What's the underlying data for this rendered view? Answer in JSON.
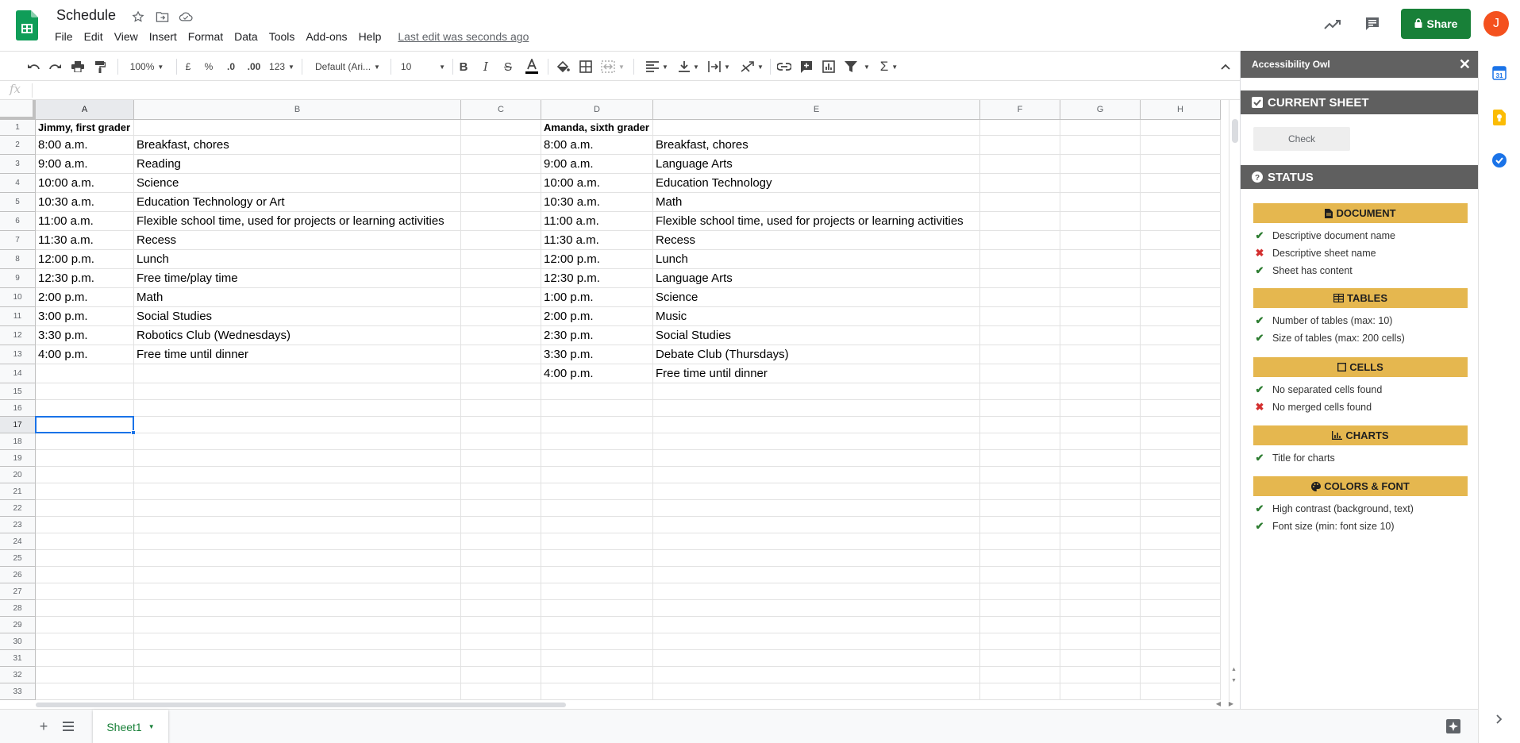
{
  "header": {
    "title": "Schedule",
    "menu": [
      "File",
      "Edit",
      "View",
      "Insert",
      "Format",
      "Data",
      "Tools",
      "Add-ons",
      "Help"
    ],
    "last_edit": "Last edit was seconds ago",
    "share_label": "Share",
    "avatar_initial": "J"
  },
  "toolbar": {
    "zoom": "100%",
    "currency": "£",
    "percent": "%",
    "dec_less": ".0",
    "dec_more": ".00",
    "format_more": "123",
    "font": "Default (Ari...",
    "font_size": "10"
  },
  "formula_bar": {
    "fx": "fx",
    "value": ""
  },
  "grid": {
    "columns": [
      "A",
      "B",
      "C",
      "D",
      "E",
      "F",
      "G",
      "H"
    ],
    "selected_column": "A",
    "selected_row": 17,
    "row_numbers": [
      1,
      2,
      3,
      4,
      5,
      6,
      7,
      8,
      9,
      10,
      11,
      12,
      13,
      14,
      15,
      16,
      17,
      18,
      19,
      20,
      21,
      22,
      23,
      24,
      25,
      26,
      27,
      28,
      29,
      30,
      31,
      32,
      33
    ],
    "rows": [
      [
        "Jimmy, first grader",
        "",
        "",
        "Amanda, sixth grader",
        ""
      ],
      [
        "8:00 a.m.",
        "Breakfast, chores",
        "",
        "8:00 a.m.",
        "Breakfast, chores"
      ],
      [
        "9:00 a.m.",
        "Reading",
        "",
        "9:00 a.m.",
        "Language Arts"
      ],
      [
        "10:00 a.m.",
        "Science",
        "",
        "10:00 a.m.",
        "Education Technology"
      ],
      [
        "10:30 a.m.",
        "Education Technology or Art",
        "",
        "10:30 a.m.",
        "Math"
      ],
      [
        "11:00 a.m.",
        "Flexible school time, used for projects or learning activities",
        "",
        "11:00 a.m.",
        "Flexible school time, used for projects or learning activities"
      ],
      [
        "11:30 a.m.",
        "Recess",
        "",
        "11:30 a.m.",
        "Recess"
      ],
      [
        "12:00 p.m.",
        "Lunch",
        "",
        "12:00 p.m.",
        "Lunch"
      ],
      [
        "12:30 p.m.",
        "Free time/play time",
        "",
        "12:30 p.m.",
        "Language Arts"
      ],
      [
        "2:00 p.m.",
        "Math",
        "",
        "1:00 p.m.",
        "Science"
      ],
      [
        "3:00 p.m.",
        "Social Studies",
        "",
        "2:00 p.m.",
        "Music"
      ],
      [
        "3:30 p.m.",
        "Robotics Club (Wednesdays)",
        "",
        "2:30 p.m.",
        "Social Studies"
      ],
      [
        "4:00 p.m.",
        "Free time until dinner",
        "",
        "3:30 p.m.",
        "Debate Club (Thursdays)"
      ],
      [
        "",
        "",
        "",
        "4:00 p.m.",
        "Free time until dinner"
      ]
    ]
  },
  "sheets": {
    "tabs": [
      "Sheet1"
    ],
    "active": "Sheet1"
  },
  "sidebar": {
    "title": "Accessibility Owl",
    "current_sheet_label": "CURRENT SHEET",
    "check_label": "Check",
    "status_label": "STATUS",
    "categories": [
      {
        "name": "DOCUMENT",
        "icon": "file-icon",
        "items": [
          {
            "label": "Descriptive document name",
            "ok": true
          },
          {
            "label": "Descriptive sheet name",
            "ok": false
          },
          {
            "label": "Sheet has content",
            "ok": true
          }
        ]
      },
      {
        "name": "TABLES",
        "icon": "table-icon",
        "items": [
          {
            "label": "Number of tables (max: 10)",
            "ok": true
          },
          {
            "label": "Size of tables (max: 200 cells)",
            "ok": true
          }
        ]
      },
      {
        "name": "CELLS",
        "icon": "square-icon",
        "items": [
          {
            "label": "No separated cells found",
            "ok": true
          },
          {
            "label": "No merged cells found",
            "ok": false
          }
        ]
      },
      {
        "name": "CHARTS",
        "icon": "chart-icon",
        "items": [
          {
            "label": "Title for charts",
            "ok": true
          }
        ]
      },
      {
        "name": "COLORS & FONT",
        "icon": "palette-icon",
        "items": [
          {
            "label": "High contrast (background, text)",
            "ok": true
          },
          {
            "label": "Font size (min: font size 10)",
            "ok": true
          }
        ]
      }
    ]
  },
  "colors": {
    "brand_green": "#188038",
    "selection_blue": "#1a73e8",
    "panel_dark": "#5f5f5f",
    "category_gold": "#e5b74f",
    "avatar_orange": "#f4511e"
  }
}
